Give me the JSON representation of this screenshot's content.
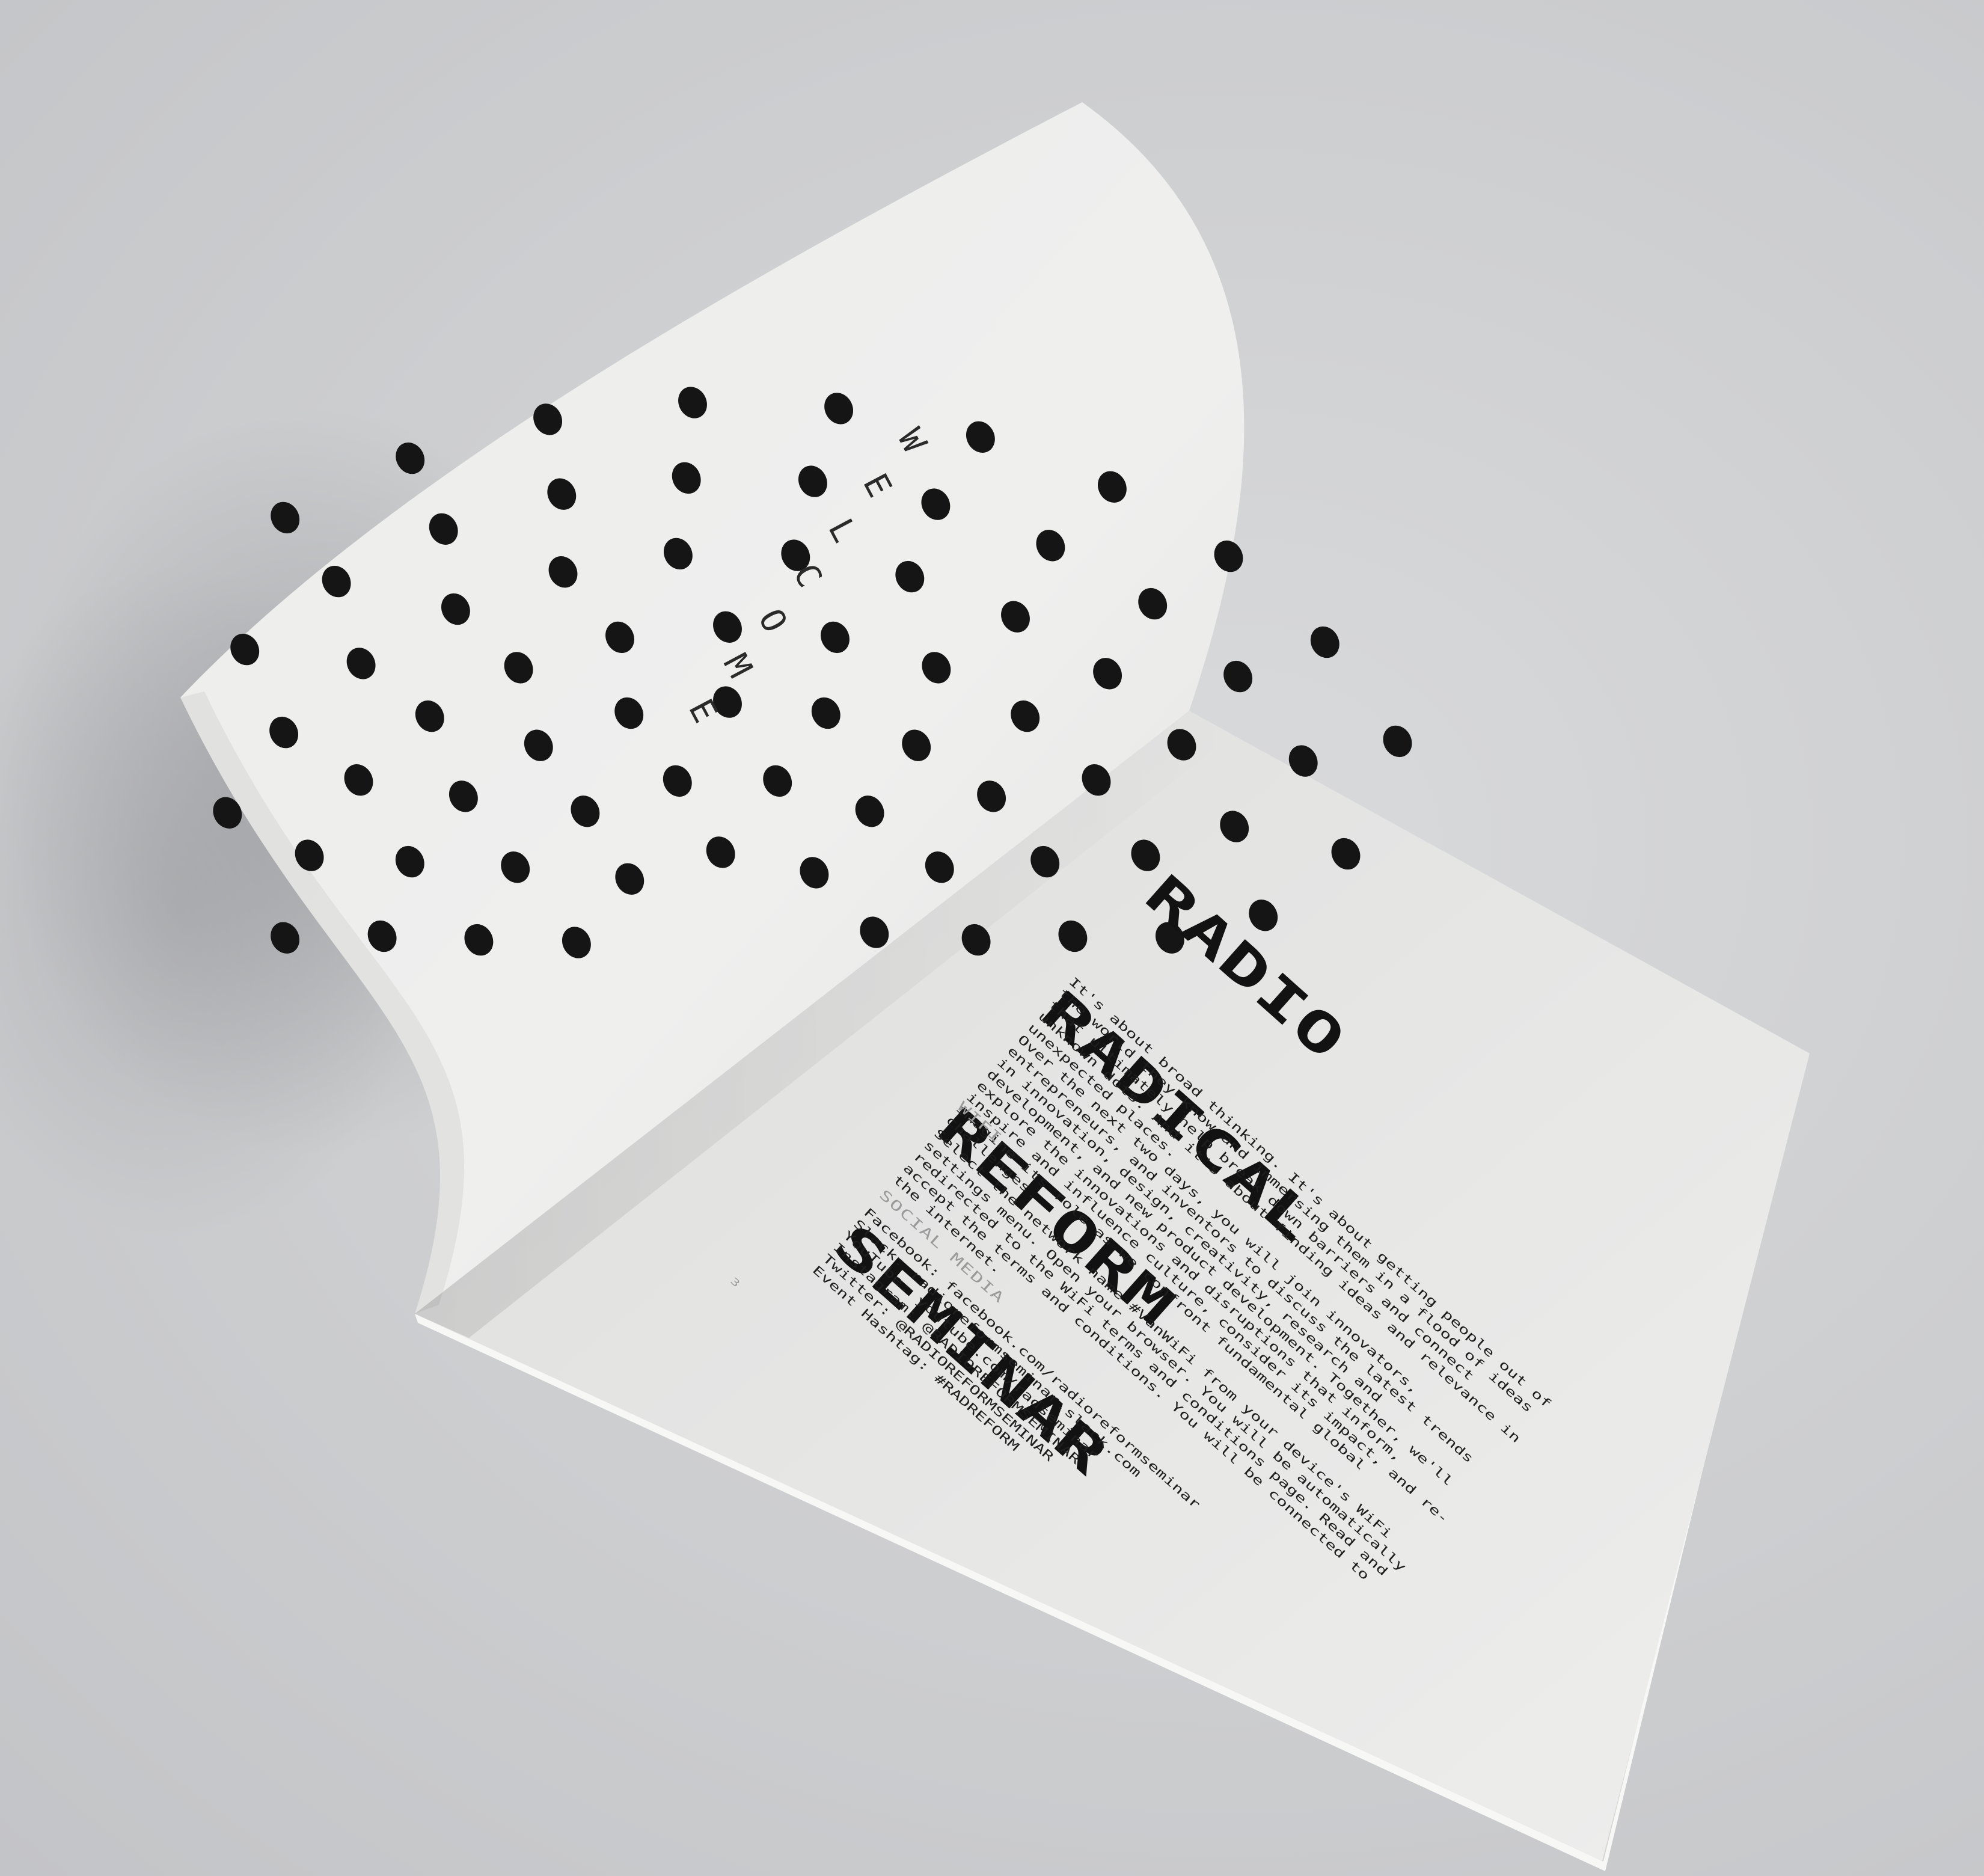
{
  "left_page": {
    "welcome_letters": [
      "W",
      "E",
      "L",
      "C",
      "O",
      "M",
      "E"
    ]
  },
  "right_page": {
    "title_lines": [
      "RADIO",
      "RADICAL",
      "REFORM",
      "SEMINAR"
    ],
    "intro_paragraph_1": "It's about broad thinking. It's about getting people out of the world they know and immersing them in a flood of ideas that ultimately help break down barriers and connect unknown dots. And it's about finding ideas and relevance in unexpected places.",
    "intro_paragraph_2": "Over the next two days, you will join innovators, entrepreneurs, and inventors to discuss the latest trends in innovation, design, creativity, research and development, and new product development. Together, we'll explore the innovations and disruptions that inform, inspire and influence culture, consider its impact, and re-imagine its role as we confront fundamental global challenges.",
    "wifi": {
      "heading": "WIFI",
      "text": "Select the network name #VanWiFi from your device's WiFi settings menu. Open your browser. You will be automatically redirected to the WiFi terms and conditions page. Read and accept the terms and conditions. You will be connected to the internet."
    },
    "social_media": {
      "heading": "SOCIAL MEDIA",
      "items": [
        "Facebook: facebook.com/radioreformseminar",
        "Slack: radioreformseminar.slack.com",
        "YouTube: youtube.com/radseminar",
        "Instagram: @RADIOREFORMSEMINAR",
        "Twitter: @RADIOREFORMSEMINAR",
        "Event Hashtag: #RADREFORM"
      ]
    },
    "page_number": "3"
  },
  "colors": {
    "background": "#cfd0d2",
    "paper": "#ebebea",
    "ink": "#141414",
    "dot": "#151515",
    "heading_gray": "#9a9a9a"
  }
}
